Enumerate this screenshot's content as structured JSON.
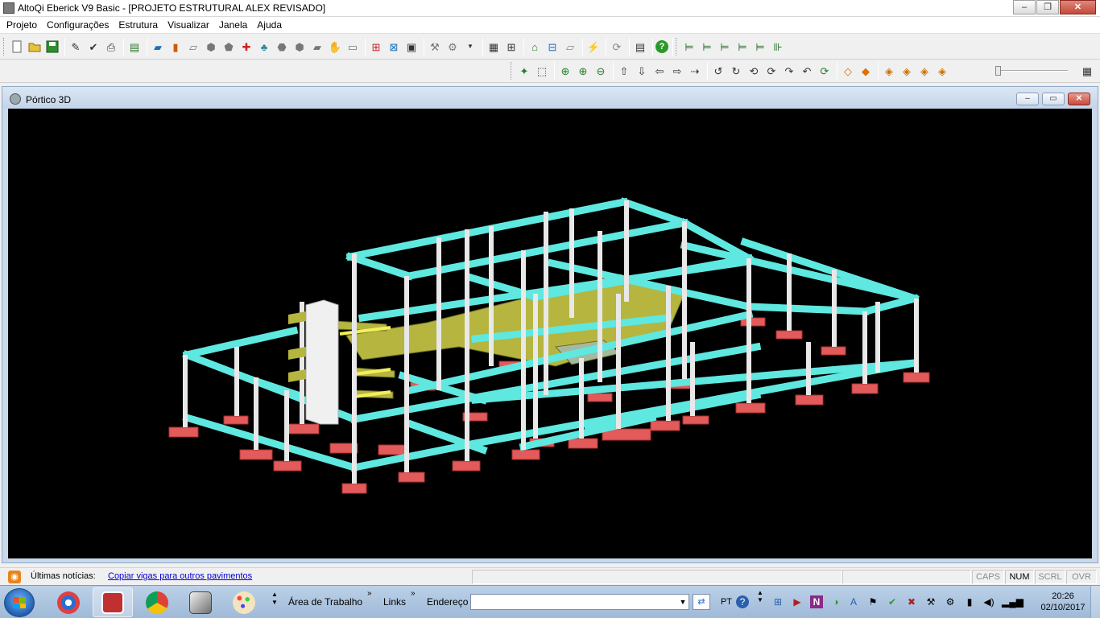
{
  "window": {
    "title": "AltoQi Eberick V9 Basic - [PROJETO ESTRUTURAL ALEX REVISADO]",
    "minimize": "‒",
    "maximize": "❐",
    "close": "✕"
  },
  "menu": {
    "items": [
      "Projeto",
      "Configurações",
      "Estrutura",
      "Visualizar",
      "Janela",
      "Ajuda"
    ]
  },
  "child_window": {
    "title": "Pórtico 3D",
    "minimize": "‒",
    "maximize": "▭",
    "close": "✕"
  },
  "viewport": {
    "background": "#000000",
    "beam_color": "#5ee8e0",
    "column_color": "#e8e8e8",
    "slab_color": "#b5b540",
    "footing_color": "#e25a5a"
  },
  "status": {
    "news_label": "Últimas notícias:",
    "news_link": "Copiar vigas para outros pavimentos",
    "indicators": [
      {
        "label": "CAPS",
        "active": false
      },
      {
        "label": "NUM",
        "active": true
      },
      {
        "label": "SCRL",
        "active": false
      },
      {
        "label": "OVR",
        "active": false
      }
    ]
  },
  "taskbar": {
    "labels": {
      "desktop": "Área de Trabalho",
      "links": "Links",
      "address": "Endereço"
    },
    "address_value": "",
    "language": "PT",
    "clock_time": "20:26",
    "clock_date": "02/10/2017"
  }
}
